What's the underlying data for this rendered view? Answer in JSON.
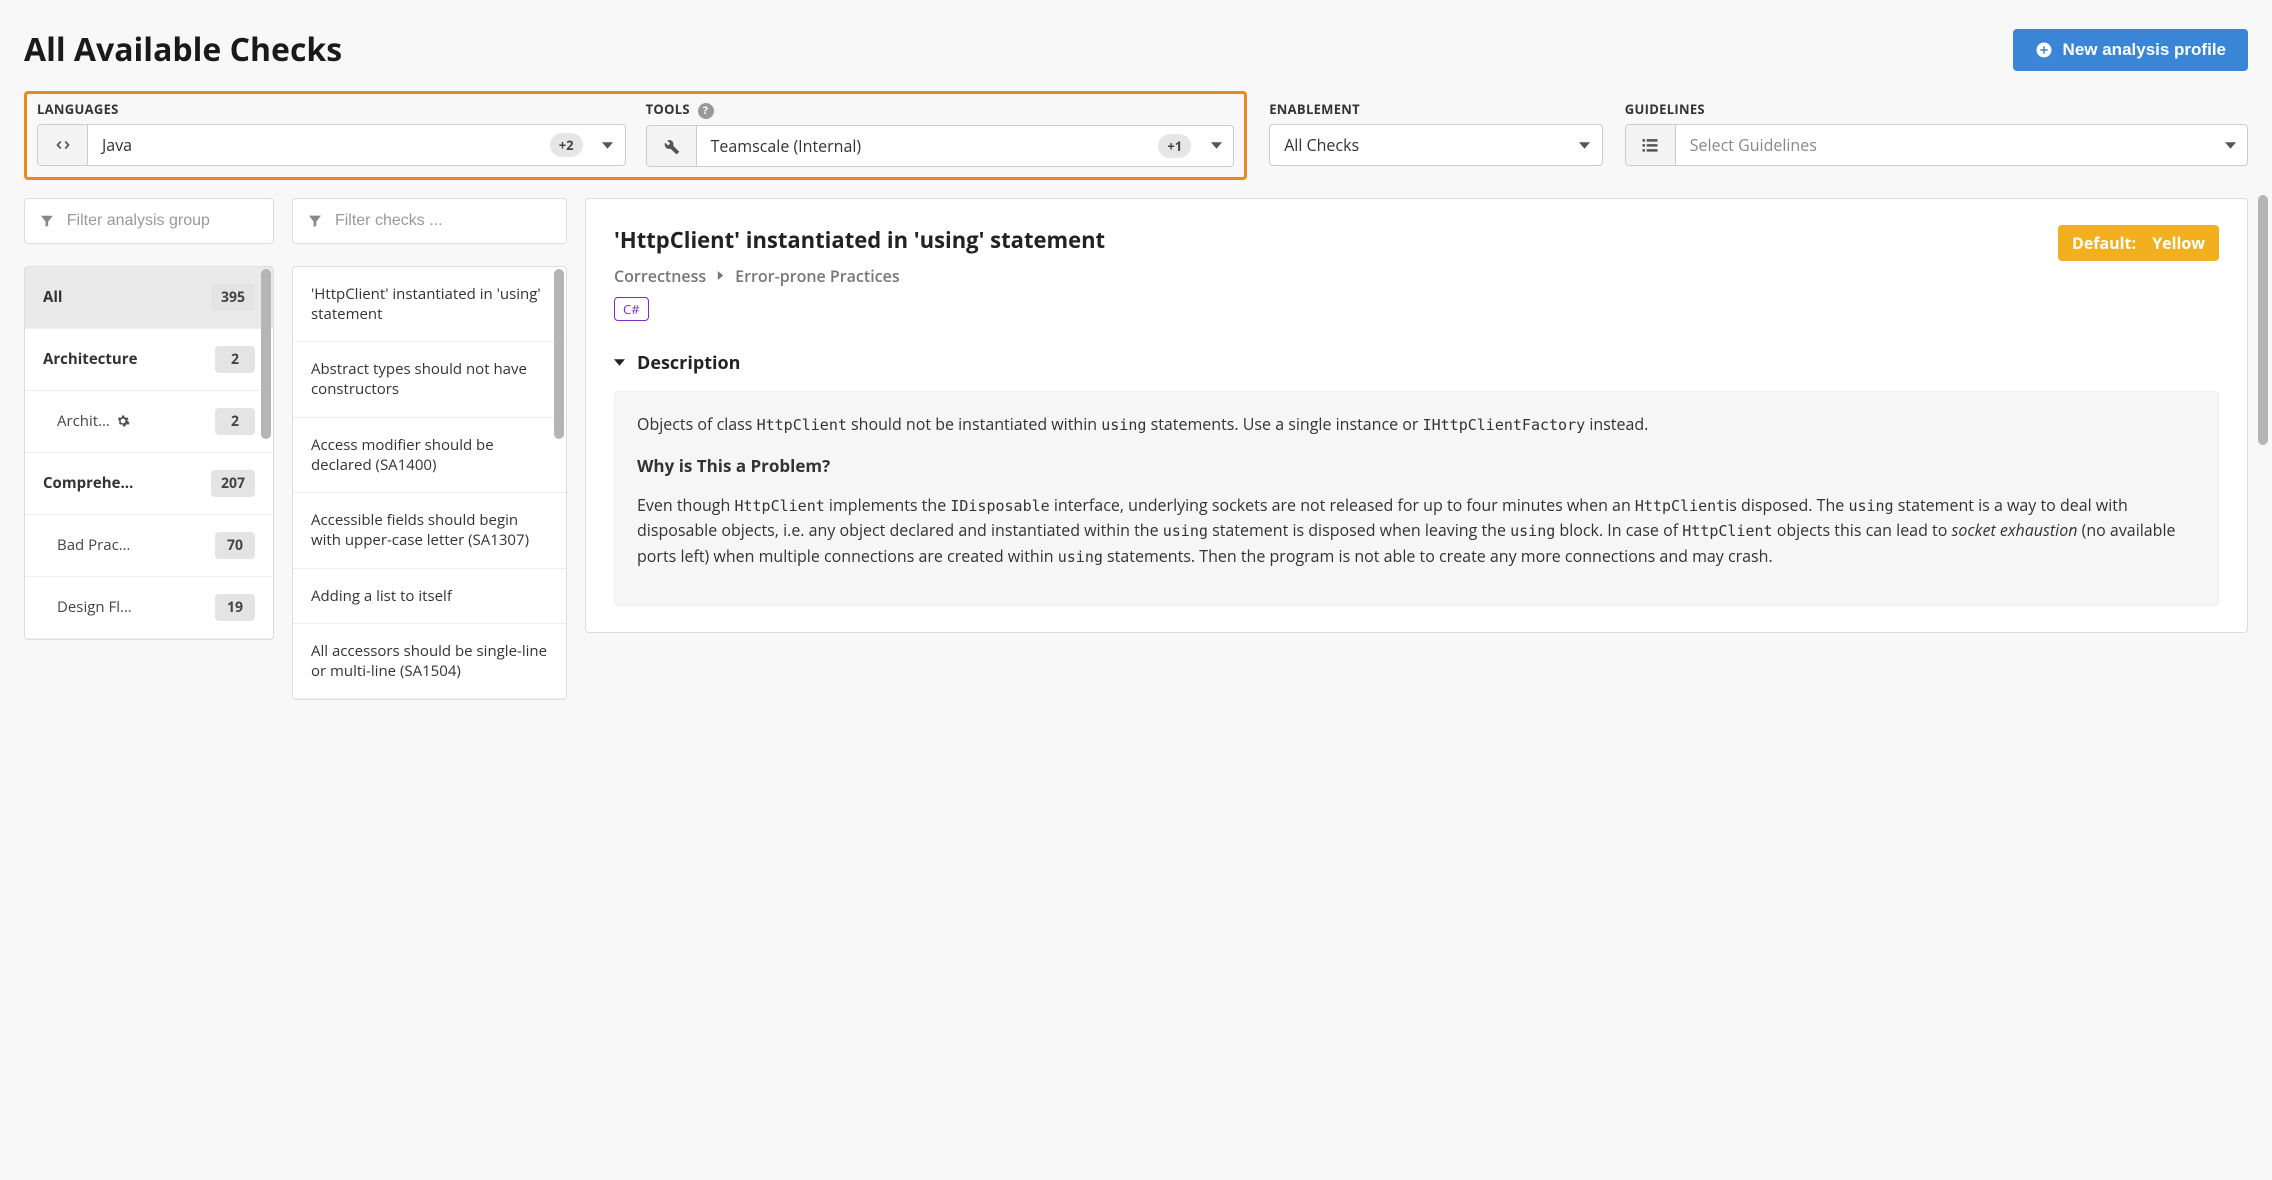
{
  "header": {
    "title": "All Available Checks",
    "new_profile_button": "New analysis profile"
  },
  "filters": {
    "languages": {
      "label": "LANGUAGES",
      "value": "Java",
      "extra_count": "+2"
    },
    "tools": {
      "label": "TOOLS",
      "value": "Teamscale (Internal)",
      "extra_count": "+1"
    },
    "enablement": {
      "label": "ENABLEMENT",
      "value": "All Checks"
    },
    "guidelines": {
      "label": "GUIDELINES",
      "placeholder": "Select Guidelines"
    }
  },
  "search": {
    "groups_placeholder": "Filter analysis group",
    "checks_placeholder": "Filter checks ..."
  },
  "groups": [
    {
      "name": "All",
      "count": "395",
      "active": true,
      "sub": false
    },
    {
      "name": "Architecture",
      "count": "2",
      "active": false,
      "sub": false
    },
    {
      "name": "Archit…",
      "count": "2",
      "active": false,
      "sub": true,
      "gear": true
    },
    {
      "name": "Comprehe…",
      "count": "207",
      "active": false,
      "sub": false
    },
    {
      "name": "Bad Prac…",
      "count": "70",
      "active": false,
      "sub": true
    },
    {
      "name": "Design Fl…",
      "count": "19",
      "active": false,
      "sub": true
    }
  ],
  "checks": [
    {
      "name": "'HttpClient' instantiated in 'using' statement",
      "active": false
    },
    {
      "name": "Abstract types should not have constructors",
      "active": false
    },
    {
      "name": "Access modifier should be declared (SA1400)",
      "active": false
    },
    {
      "name": "Accessible fields should begin with upper-case letter (SA1307)",
      "active": false
    },
    {
      "name": "Adding a list to itself",
      "active": false
    },
    {
      "name": "All accessors should be single-line or multi-line (SA1504)",
      "active": false
    }
  ],
  "detail": {
    "title": "'HttpClient' instantiated in 'using' statement",
    "default_badge_prefix": "Default:",
    "default_badge_value": "Yellow",
    "breadcrumb_1": "Correctness",
    "breadcrumb_2": "Error-prone Practices",
    "language_chip": "C#",
    "section_title": "Description",
    "para1_a": "Objects of class ",
    "para1_code1": "HttpClient",
    "para1_b": " should not be instantiated within ",
    "para1_code2": "using",
    "para1_c": " statements. Use a single instance or ",
    "para1_code3": "IHttpClientFactory",
    "para1_d": " instead.",
    "subheading": "Why is This a Problem?",
    "para2_a": "Even though ",
    "para2_code1": "HttpClient",
    "para2_b": " implements the ",
    "para2_code2": "IDisposable",
    "para2_c": " interface, underlying sockets are not released for up to four minutes when an ",
    "para2_code3": "HttpClient",
    "para2_d": "is disposed. The ",
    "para2_code4": "using",
    "para2_e": " statement is a way to deal with disposable objects, i.e. any object declared and instantiated within the ",
    "para2_code5": "using",
    "para2_f": " statement is disposed when leaving the ",
    "para2_code6": "using",
    "para2_g": " block. In case of ",
    "para2_code7": "HttpClient",
    "para2_h": " objects this can lead to ",
    "para2_em": "socket exhaustion",
    "para2_i": " (no available ports left) when multiple connections are created within ",
    "para2_code8": "using",
    "para2_j": " statements. Then the program is not able to create any more connections and may crash."
  }
}
